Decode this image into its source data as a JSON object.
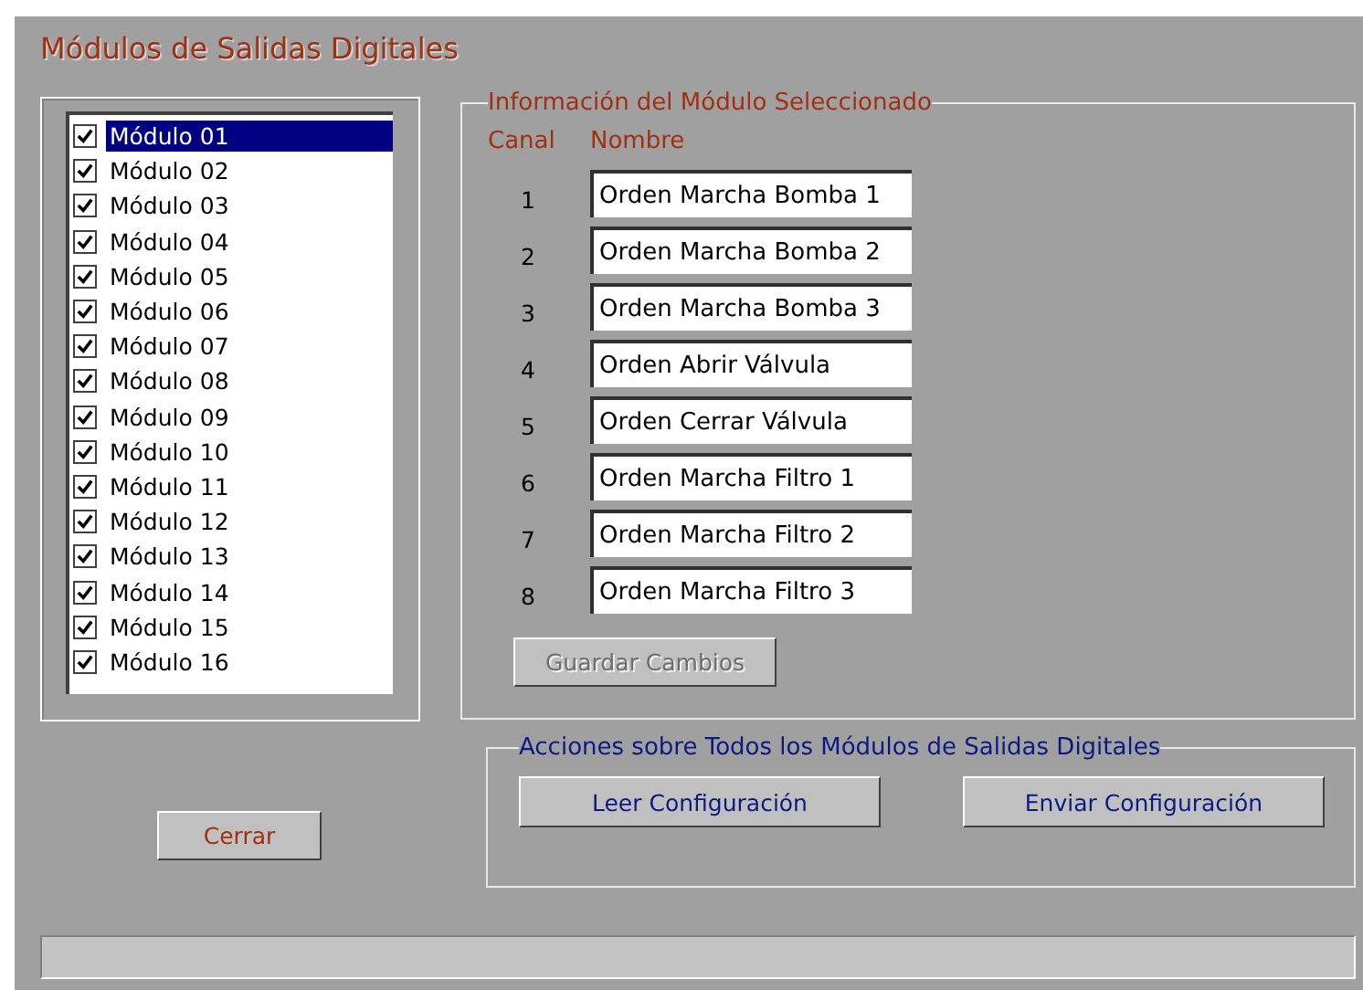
{
  "window": {
    "title": "Módulos de Salidas Digitales"
  },
  "modules": [
    {
      "label": "Módulo 01",
      "checked": true,
      "selected": true
    },
    {
      "label": "Módulo 02",
      "checked": true,
      "selected": false
    },
    {
      "label": "Módulo 03",
      "checked": true,
      "selected": false
    },
    {
      "label": "Módulo 04",
      "checked": true,
      "selected": false
    },
    {
      "label": "Módulo 05",
      "checked": true,
      "selected": false
    },
    {
      "label": "Módulo 06",
      "checked": true,
      "selected": false
    },
    {
      "label": "Módulo 07",
      "checked": true,
      "selected": false
    },
    {
      "label": "Módulo 08",
      "checked": true,
      "selected": false
    },
    {
      "label": "Módulo 09",
      "checked": true,
      "selected": false
    },
    {
      "label": "Módulo 10",
      "checked": true,
      "selected": false
    },
    {
      "label": "Módulo 11",
      "checked": true,
      "selected": false
    },
    {
      "label": "Módulo 12",
      "checked": true,
      "selected": false
    },
    {
      "label": "Módulo 13",
      "checked": true,
      "selected": false
    },
    {
      "label": "Módulo 14",
      "checked": true,
      "selected": false
    },
    {
      "label": "Módulo 15",
      "checked": true,
      "selected": false
    },
    {
      "label": "Módulo 16",
      "checked": true,
      "selected": false
    }
  ],
  "module_info": {
    "title": "Información del Módulo Seleccionado",
    "columns": [
      "Canal",
      "Nombre"
    ],
    "channels": [
      {
        "number": "1",
        "name": "Orden Marcha Bomba 1"
      },
      {
        "number": "2",
        "name": "Orden Marcha Bomba 2"
      },
      {
        "number": "3",
        "name": "Orden Marcha Bomba 3"
      },
      {
        "number": "4",
        "name": "Orden Abrir Válvula"
      },
      {
        "number": "5",
        "name": "Orden Cerrar Válvula"
      },
      {
        "number": "6",
        "name": "Orden Marcha Filtro 1"
      },
      {
        "number": "7",
        "name": "Orden Marcha Filtro 2"
      },
      {
        "number": "8",
        "name": "Orden Marcha Filtro 3"
      }
    ],
    "save_button": {
      "label": "Guardar Cambios",
      "disabled": true
    }
  },
  "close_button": {
    "label": "Cerrar"
  },
  "actions": {
    "title": "Acciones sobre Todos los Módulos de Salidas Digitales",
    "buttons": [
      "Leer Configuración",
      "Enviar Configuración"
    ]
  }
}
